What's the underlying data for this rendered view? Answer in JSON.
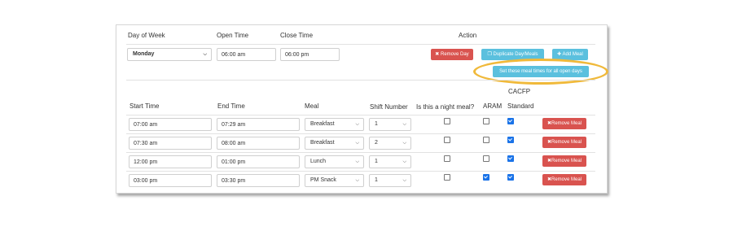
{
  "day_section": {
    "headers": {
      "day": "Day of Week",
      "open": "Open Time",
      "close": "Close Time",
      "action": "Action"
    },
    "day_value": "Monday",
    "open_value": "06:00 am",
    "close_value": "06:00 pm",
    "remove_day": "Remove Day",
    "duplicate": "Duplicate Day/Meals",
    "add_meal": "Add Meal",
    "set_meal_times": "Set these meal times for all open days"
  },
  "meals": {
    "headers": {
      "start": "Start Time",
      "end": "End Time",
      "meal": "Meal",
      "shift": "Shift Number",
      "night": "Is this a night meal?",
      "aram": "ARAM",
      "cacfp_1": "CACFP",
      "cacfp_2": "Standard"
    },
    "remove_label": "Remove Meal",
    "rows": [
      {
        "start": "07:00 am",
        "end": "07:29 am",
        "meal": "Breakfast",
        "shift": "1",
        "night": false,
        "aram": false,
        "cacfp": true
      },
      {
        "start": "07:30 am",
        "end": "08:00 am",
        "meal": "Breakfast",
        "shift": "2",
        "night": false,
        "aram": false,
        "cacfp": true
      },
      {
        "start": "12:00 pm",
        "end": "01:00 pm",
        "meal": "Lunch",
        "shift": "1",
        "night": false,
        "aram": false,
        "cacfp": true
      },
      {
        "start": "03:00 pm",
        "end": "03:30 pm",
        "meal": "PM Snack",
        "shift": "1",
        "night": false,
        "aram": true,
        "cacfp": true
      }
    ]
  },
  "colors": {
    "danger": "#d9534f",
    "info": "#5bc0de",
    "highlight": "#f0b93a",
    "checkbox": "#1a73e8"
  },
  "icons": {
    "remove": "times-icon",
    "duplicate": "copy-icon",
    "add": "plus-icon",
    "dropdown": "chevron-down-icon"
  }
}
